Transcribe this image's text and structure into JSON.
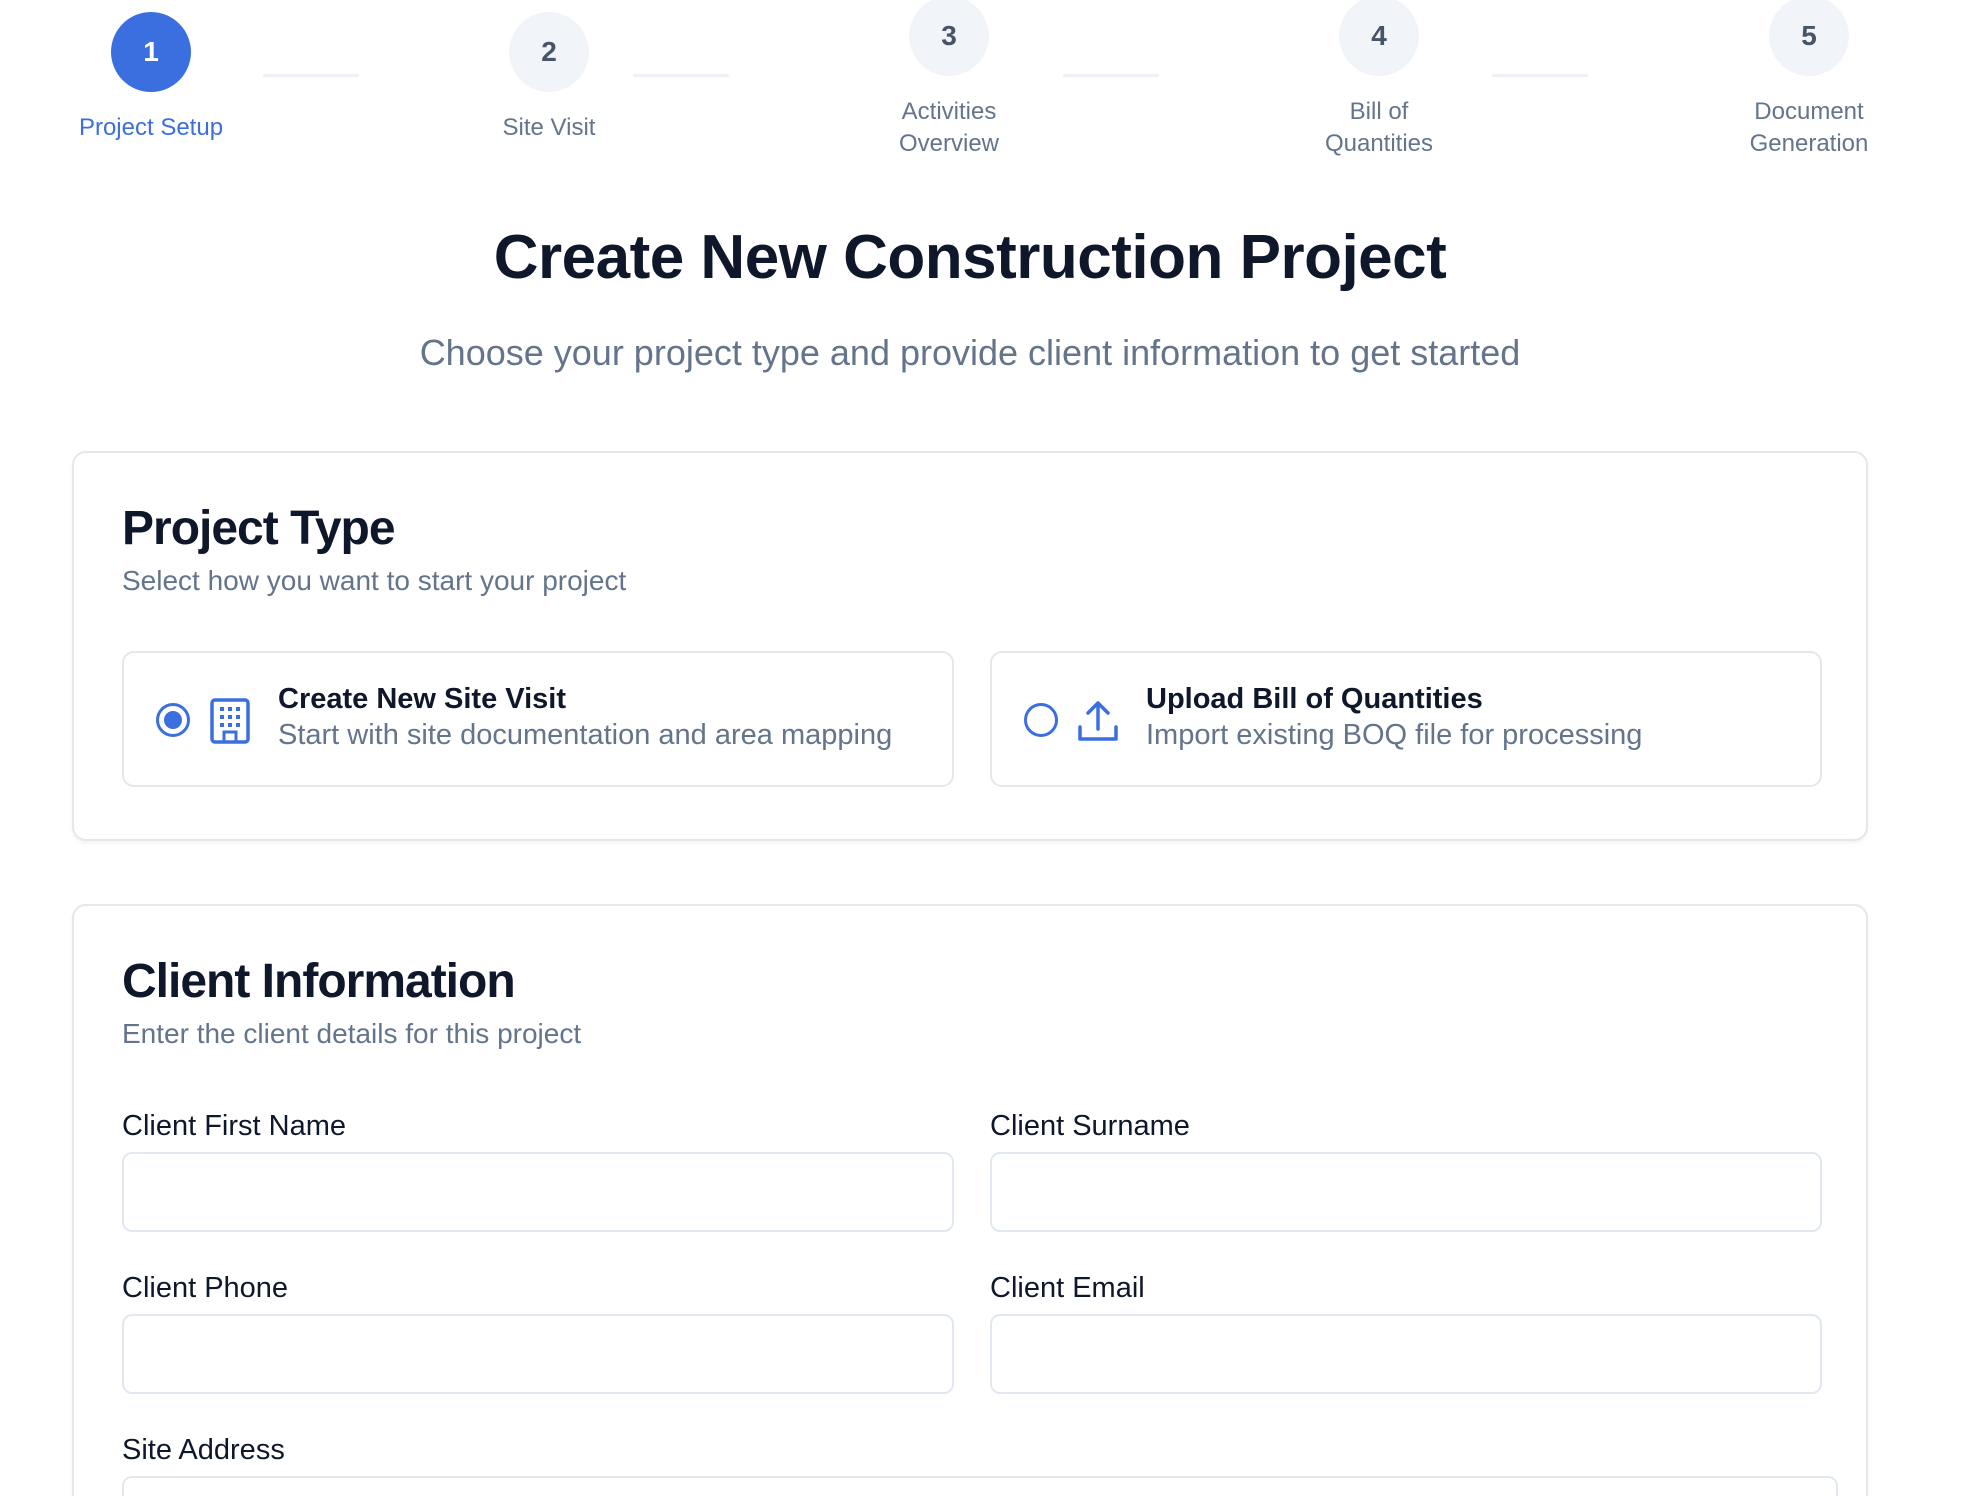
{
  "stepper": {
    "steps": [
      {
        "number": "1",
        "label": "Project Setup",
        "active": true
      },
      {
        "number": "2",
        "label": "Site Visit",
        "active": false
      },
      {
        "number": "3",
        "label": "Activities\nOverview",
        "active": false
      },
      {
        "number": "4",
        "label": "Bill of\nQuantities",
        "active": false
      },
      {
        "number": "5",
        "label": "Document\nGeneration",
        "active": false
      }
    ]
  },
  "hero": {
    "title": "Create New Construction Project",
    "subtitle": "Choose your project type and provide client information to get started"
  },
  "project_type": {
    "title": "Project Type",
    "description": "Select how you want to start your project",
    "options": [
      {
        "title": "Create New Site Visit",
        "description": "Start with site documentation and area mapping",
        "icon": "building-icon",
        "selected": true
      },
      {
        "title": "Upload Bill of Quantities",
        "description": "Import existing BOQ file for processing",
        "icon": "upload-icon",
        "selected": false
      }
    ]
  },
  "client_info": {
    "title": "Client Information",
    "description": "Enter the client details for this project",
    "fields": {
      "first_name": {
        "label": "Client First Name",
        "value": "",
        "placeholder": ""
      },
      "surname": {
        "label": "Client Surname",
        "value": "",
        "placeholder": ""
      },
      "phone": {
        "label": "Client Phone",
        "value": "",
        "placeholder": ""
      },
      "email": {
        "label": "Client Email",
        "value": "",
        "placeholder": ""
      },
      "site_address": {
        "label": "Site Address",
        "value": "",
        "placeholder": ""
      }
    }
  },
  "colors": {
    "accent": "#3b6fe0",
    "muted_text": "#64748b",
    "heading": "#0f172a",
    "border": "#e5e7eb"
  }
}
